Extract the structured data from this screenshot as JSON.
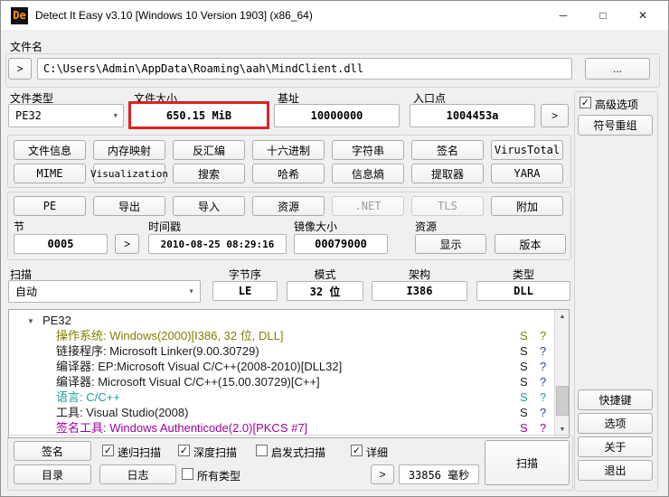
{
  "window": {
    "title": "Detect It Easy v3.10 [Windows 10 Version 1903] (x86_64)",
    "icon_text": "De",
    "minimize": "─",
    "maximize": "□",
    "close": "✕"
  },
  "glyphs": {
    "check": "✓",
    "combo_arrow": "▼",
    "expander": "▼",
    "scroll_up": "▲",
    "scroll_down": "▼",
    "chevron": ">"
  },
  "colors": {
    "highlight_red": "#dd2222",
    "os_row_olive": "#808000",
    "language_row_teal": "#1f9e9e",
    "signtool_row_purple": "#a000a0"
  },
  "file": {
    "label": "文件名",
    "path": "C:\\Users\\Admin\\AppData\\Roaming\\aah\\MindClient.dll",
    "browse": "..."
  },
  "info": {
    "type_label": "文件类型",
    "type_value": "PE32",
    "size_label": "文件大小",
    "size_value": "650.15 MiB",
    "base_label": "基址",
    "base_value": "10000000",
    "entry_label": "入口点",
    "entry_value": "1004453a"
  },
  "advanced": {
    "label": "高级选项",
    "demangle": "符号重组"
  },
  "tools": {
    "row1": [
      "文件信息",
      "内存映射",
      "反汇编",
      "十六进制",
      "字符串",
      "签名",
      "VirusTotal"
    ],
    "row2": [
      "MIME",
      "Visualization",
      "搜索",
      "哈希",
      "信息熵",
      "提取器",
      "YARA"
    ],
    "row3": [
      {
        "label": "PE",
        "disabled": false
      },
      {
        "label": "导出",
        "disabled": false
      },
      {
        "label": "导入",
        "disabled": false
      },
      {
        "label": "资源",
        "disabled": false
      },
      {
        "label": ".NET",
        "disabled": true
      },
      {
        "label": "TLS",
        "disabled": true
      },
      {
        "label": "附加",
        "disabled": false
      }
    ]
  },
  "pe": {
    "sections_label": "节",
    "sections_value": "0005",
    "timestamp_label": "时间戳",
    "timestamp_value": "2010-08-25 08:29:16",
    "imagesize_label": "镜像大小",
    "imagesize_value": "00079000",
    "resources_label": "资源",
    "show_button": "显示",
    "version_button": "版本"
  },
  "scan": {
    "label": "扫描",
    "engine_value": "自动",
    "endian_label": "字节序",
    "endian_value": "LE",
    "mode_label": "模式",
    "mode_value": "32 位",
    "arch_label": "架构",
    "arch_value": "I386",
    "type_label": "类型",
    "type_value": "DLL"
  },
  "results": {
    "root": "PE32",
    "s": "S",
    "q": "?",
    "rows": [
      {
        "label": "操作系统",
        "value": "Windows(2000)[I386, 32 位, DLL]",
        "color": "#808000",
        "qcolor": "#808000"
      },
      {
        "label": "链接程序",
        "value": "Microsoft Linker(9.00.30729)",
        "color": "#1b1b1b",
        "qcolor": "#2a4d8f"
      },
      {
        "label": "编译器",
        "value": "EP:Microsoft Visual C/C++(2008-2010)[DLL32]",
        "color": "#1b1b1b",
        "qcolor": "#2a4d8f"
      },
      {
        "label": "编译器",
        "value": "Microsoft Visual C/C++(15.00.30729)[C++]",
        "color": "#1b1b1b",
        "qcolor": "#2a4d8f"
      },
      {
        "label": "语言",
        "value": "C/C++",
        "color": "#1f9e9e",
        "qcolor": "#1f9e9e"
      },
      {
        "label": "工具",
        "value": "Visual Studio(2008)",
        "color": "#1b1b1b",
        "qcolor": "#2a4d8f"
      },
      {
        "label": "签名工具",
        "value": "Windows Authenticode(2.0)[PKCS #7]",
        "color": "#a000a0",
        "qcolor": "#a000a0"
      }
    ]
  },
  "bottom": {
    "signatures": "签名",
    "directory": "目录",
    "log": "日志",
    "recursive": "递归扫描",
    "deep": "深度扫描",
    "heuristic": "启发式扫描",
    "verbose": "详细",
    "alltypes": "所有类型",
    "elapsed": "33856 毫秒",
    "scan": "扫描",
    "shortcuts": "快捷键",
    "options": "选项",
    "about": "关于",
    "exit": "退出"
  },
  "checks": {
    "advanced": true,
    "recursive": true,
    "deep": true,
    "heuristic": false,
    "verbose": true,
    "alltypes": false
  }
}
